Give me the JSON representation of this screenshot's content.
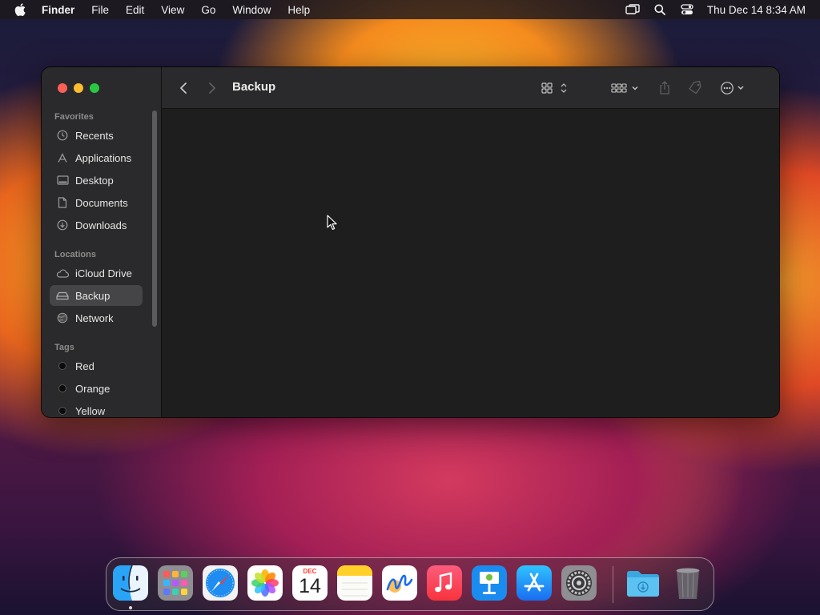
{
  "menubar": {
    "app_name": "Finder",
    "menus": [
      "File",
      "Edit",
      "View",
      "Go",
      "Window",
      "Help"
    ],
    "clock": "Thu Dec 14  8:34 AM"
  },
  "window": {
    "title": "Backup",
    "sidebar": {
      "favorites_title": "Favorites",
      "favorites": [
        "Recents",
        "Applications",
        "Desktop",
        "Documents",
        "Downloads"
      ],
      "locations_title": "Locations",
      "locations": [
        "iCloud Drive",
        "Backup",
        "Network"
      ],
      "selected": "Backup",
      "tags_title": "Tags",
      "tags": [
        "Red",
        "Orange",
        "Yellow"
      ]
    },
    "toolbar_icons": [
      "back-icon",
      "forward-icon",
      "grid-view-icon",
      "group-icon",
      "share-icon",
      "tag-icon",
      "more-actions-icon",
      "search-icon"
    ]
  },
  "dock": {
    "apps": [
      "Finder",
      "Launchpad",
      "Safari",
      "Photos",
      "Calendar",
      "Notes",
      "Freeform",
      "Music",
      "Keynote",
      "App Store",
      "System Settings",
      "Downloads",
      "Trash"
    ],
    "calendar_month": "DEC",
    "calendar_day": "14"
  }
}
